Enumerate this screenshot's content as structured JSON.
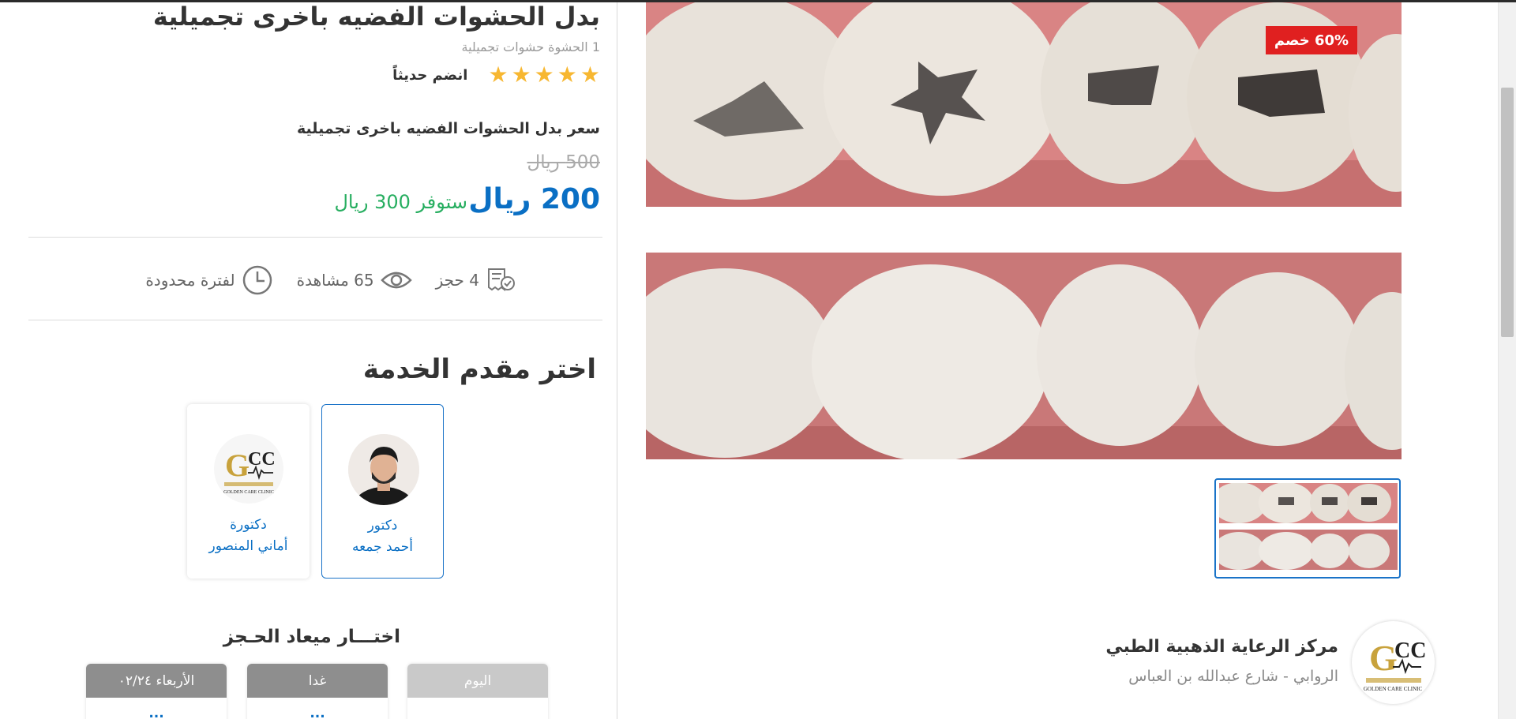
{
  "service": {
    "title": "بدل الحشوات الفضيه باخرى تجميلية",
    "subtitle": "1 الحشوة حشوات تجميلية",
    "rating_stars": 5,
    "joined_label": "انضم حديثاً",
    "price_heading": "سعر بدل الحشوات الفضيه باخرى تجميلية",
    "old_price": "500 ريال",
    "new_price": "200 ريال",
    "savings": "ستوفر 300 ريال",
    "discount_badge": "60% خصم"
  },
  "stats": {
    "bookings": "4 حجز",
    "views": "65 مشاهدة",
    "duration": "لفترة محدودة"
  },
  "providers": {
    "heading": "اختر مقدم الخدمة",
    "items": [
      {
        "title": "دكتور",
        "name": "أحمد جمعه",
        "selected": true
      },
      {
        "title": "دكتورة",
        "name": "أماني المنصور",
        "selected": false
      }
    ]
  },
  "appointment": {
    "heading": "اختـــار ميعاد الحـجز",
    "days": [
      {
        "label": "اليوم",
        "slot": ""
      },
      {
        "label": "غدا",
        "slot": "..."
      },
      {
        "label": "الأربعاء ٠٢/٢٤",
        "slot": "..."
      }
    ]
  },
  "center": {
    "name": "مركز الرعاية الذهبية الطبي",
    "address": "الروابي - شارع عبدالله بن العباس",
    "logo_text": "GCC",
    "logo_sub": "GOLDEN CARE CLINIC"
  },
  "colors": {
    "accent": "#0a6fc4",
    "badge": "#e02020",
    "savings": "#27ae60",
    "star": "#f7b731"
  }
}
